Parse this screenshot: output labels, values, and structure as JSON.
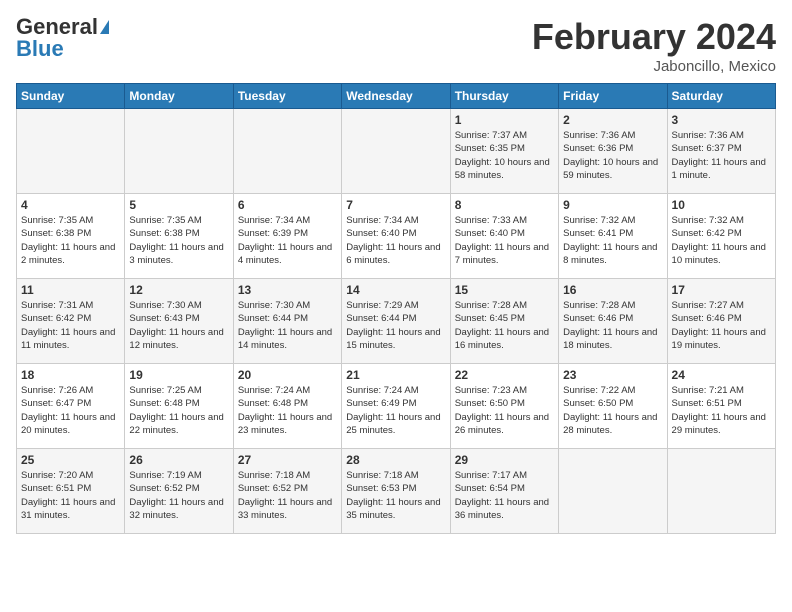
{
  "header": {
    "logo_general": "General",
    "logo_blue": "Blue",
    "month_year": "February 2024",
    "location": "Jaboncillo, Mexico"
  },
  "days_of_week": [
    "Sunday",
    "Monday",
    "Tuesday",
    "Wednesday",
    "Thursday",
    "Friday",
    "Saturday"
  ],
  "weeks": [
    [
      {
        "day": "",
        "sunrise": "",
        "sunset": "",
        "daylight": ""
      },
      {
        "day": "",
        "sunrise": "",
        "sunset": "",
        "daylight": ""
      },
      {
        "day": "",
        "sunrise": "",
        "sunset": "",
        "daylight": ""
      },
      {
        "day": "",
        "sunrise": "",
        "sunset": "",
        "daylight": ""
      },
      {
        "day": "1",
        "sunrise": "Sunrise: 7:37 AM",
        "sunset": "Sunset: 6:35 PM",
        "daylight": "Daylight: 10 hours and 58 minutes."
      },
      {
        "day": "2",
        "sunrise": "Sunrise: 7:36 AM",
        "sunset": "Sunset: 6:36 PM",
        "daylight": "Daylight: 10 hours and 59 minutes."
      },
      {
        "day": "3",
        "sunrise": "Sunrise: 7:36 AM",
        "sunset": "Sunset: 6:37 PM",
        "daylight": "Daylight: 11 hours and 1 minute."
      }
    ],
    [
      {
        "day": "4",
        "sunrise": "Sunrise: 7:35 AM",
        "sunset": "Sunset: 6:38 PM",
        "daylight": "Daylight: 11 hours and 2 minutes."
      },
      {
        "day": "5",
        "sunrise": "Sunrise: 7:35 AM",
        "sunset": "Sunset: 6:38 PM",
        "daylight": "Daylight: 11 hours and 3 minutes."
      },
      {
        "day": "6",
        "sunrise": "Sunrise: 7:34 AM",
        "sunset": "Sunset: 6:39 PM",
        "daylight": "Daylight: 11 hours and 4 minutes."
      },
      {
        "day": "7",
        "sunrise": "Sunrise: 7:34 AM",
        "sunset": "Sunset: 6:40 PM",
        "daylight": "Daylight: 11 hours and 6 minutes."
      },
      {
        "day": "8",
        "sunrise": "Sunrise: 7:33 AM",
        "sunset": "Sunset: 6:40 PM",
        "daylight": "Daylight: 11 hours and 7 minutes."
      },
      {
        "day": "9",
        "sunrise": "Sunrise: 7:32 AM",
        "sunset": "Sunset: 6:41 PM",
        "daylight": "Daylight: 11 hours and 8 minutes."
      },
      {
        "day": "10",
        "sunrise": "Sunrise: 7:32 AM",
        "sunset": "Sunset: 6:42 PM",
        "daylight": "Daylight: 11 hours and 10 minutes."
      }
    ],
    [
      {
        "day": "11",
        "sunrise": "Sunrise: 7:31 AM",
        "sunset": "Sunset: 6:42 PM",
        "daylight": "Daylight: 11 hours and 11 minutes."
      },
      {
        "day": "12",
        "sunrise": "Sunrise: 7:30 AM",
        "sunset": "Sunset: 6:43 PM",
        "daylight": "Daylight: 11 hours and 12 minutes."
      },
      {
        "day": "13",
        "sunrise": "Sunrise: 7:30 AM",
        "sunset": "Sunset: 6:44 PM",
        "daylight": "Daylight: 11 hours and 14 minutes."
      },
      {
        "day": "14",
        "sunrise": "Sunrise: 7:29 AM",
        "sunset": "Sunset: 6:44 PM",
        "daylight": "Daylight: 11 hours and 15 minutes."
      },
      {
        "day": "15",
        "sunrise": "Sunrise: 7:28 AM",
        "sunset": "Sunset: 6:45 PM",
        "daylight": "Daylight: 11 hours and 16 minutes."
      },
      {
        "day": "16",
        "sunrise": "Sunrise: 7:28 AM",
        "sunset": "Sunset: 6:46 PM",
        "daylight": "Daylight: 11 hours and 18 minutes."
      },
      {
        "day": "17",
        "sunrise": "Sunrise: 7:27 AM",
        "sunset": "Sunset: 6:46 PM",
        "daylight": "Daylight: 11 hours and 19 minutes."
      }
    ],
    [
      {
        "day": "18",
        "sunrise": "Sunrise: 7:26 AM",
        "sunset": "Sunset: 6:47 PM",
        "daylight": "Daylight: 11 hours and 20 minutes."
      },
      {
        "day": "19",
        "sunrise": "Sunrise: 7:25 AM",
        "sunset": "Sunset: 6:48 PM",
        "daylight": "Daylight: 11 hours and 22 minutes."
      },
      {
        "day": "20",
        "sunrise": "Sunrise: 7:24 AM",
        "sunset": "Sunset: 6:48 PM",
        "daylight": "Daylight: 11 hours and 23 minutes."
      },
      {
        "day": "21",
        "sunrise": "Sunrise: 7:24 AM",
        "sunset": "Sunset: 6:49 PM",
        "daylight": "Daylight: 11 hours and 25 minutes."
      },
      {
        "day": "22",
        "sunrise": "Sunrise: 7:23 AM",
        "sunset": "Sunset: 6:50 PM",
        "daylight": "Daylight: 11 hours and 26 minutes."
      },
      {
        "day": "23",
        "sunrise": "Sunrise: 7:22 AM",
        "sunset": "Sunset: 6:50 PM",
        "daylight": "Daylight: 11 hours and 28 minutes."
      },
      {
        "day": "24",
        "sunrise": "Sunrise: 7:21 AM",
        "sunset": "Sunset: 6:51 PM",
        "daylight": "Daylight: 11 hours and 29 minutes."
      }
    ],
    [
      {
        "day": "25",
        "sunrise": "Sunrise: 7:20 AM",
        "sunset": "Sunset: 6:51 PM",
        "daylight": "Daylight: 11 hours and 31 minutes."
      },
      {
        "day": "26",
        "sunrise": "Sunrise: 7:19 AM",
        "sunset": "Sunset: 6:52 PM",
        "daylight": "Daylight: 11 hours and 32 minutes."
      },
      {
        "day": "27",
        "sunrise": "Sunrise: 7:18 AM",
        "sunset": "Sunset: 6:52 PM",
        "daylight": "Daylight: 11 hours and 33 minutes."
      },
      {
        "day": "28",
        "sunrise": "Sunrise: 7:18 AM",
        "sunset": "Sunset: 6:53 PM",
        "daylight": "Daylight: 11 hours and 35 minutes."
      },
      {
        "day": "29",
        "sunrise": "Sunrise: 7:17 AM",
        "sunset": "Sunset: 6:54 PM",
        "daylight": "Daylight: 11 hours and 36 minutes."
      },
      {
        "day": "",
        "sunrise": "",
        "sunset": "",
        "daylight": ""
      },
      {
        "day": "",
        "sunrise": "",
        "sunset": "",
        "daylight": ""
      }
    ]
  ]
}
